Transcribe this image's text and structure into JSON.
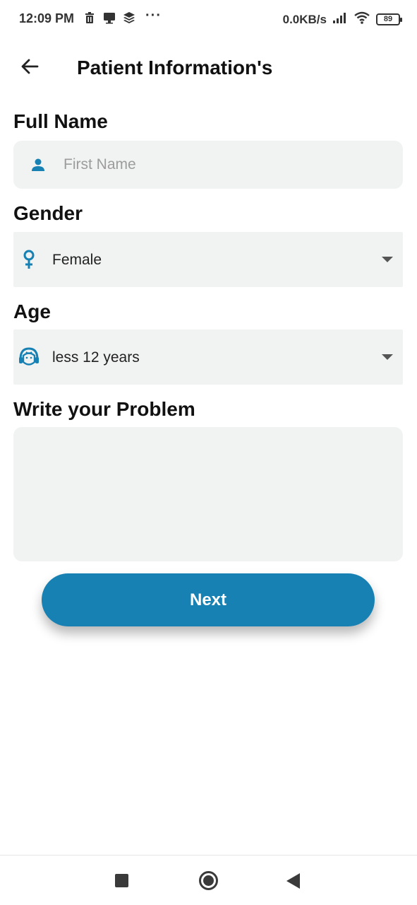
{
  "status_bar": {
    "time": "12:09 PM",
    "left_icons": [
      "trash-icon",
      "gallery-icon",
      "layers-icon"
    ],
    "more": "···",
    "network_speed": "0.0KB/s",
    "battery_level": "89"
  },
  "app_bar": {
    "back_icon": "arrow-left-icon",
    "title": "Patient Information's"
  },
  "form": {
    "full_name": {
      "label": "Full Name",
      "icon": "person-icon",
      "placeholder": "First Name",
      "value": ""
    },
    "gender": {
      "label": "Gender",
      "icon": "female-icon",
      "value": "Female"
    },
    "age": {
      "label": "Age",
      "icon": "child-face-icon",
      "value": "less 12 years"
    },
    "problem": {
      "label": "Write your Problem",
      "value": ""
    }
  },
  "next_button": {
    "label": "Next"
  },
  "colors": {
    "accent": "#1781b4",
    "field_background": "#f1f2f2",
    "placeholder": "#9c9c9c"
  },
  "nav_bar": {
    "icons": [
      "recents-square-icon",
      "home-circle-icon",
      "back-triangle-icon"
    ]
  }
}
